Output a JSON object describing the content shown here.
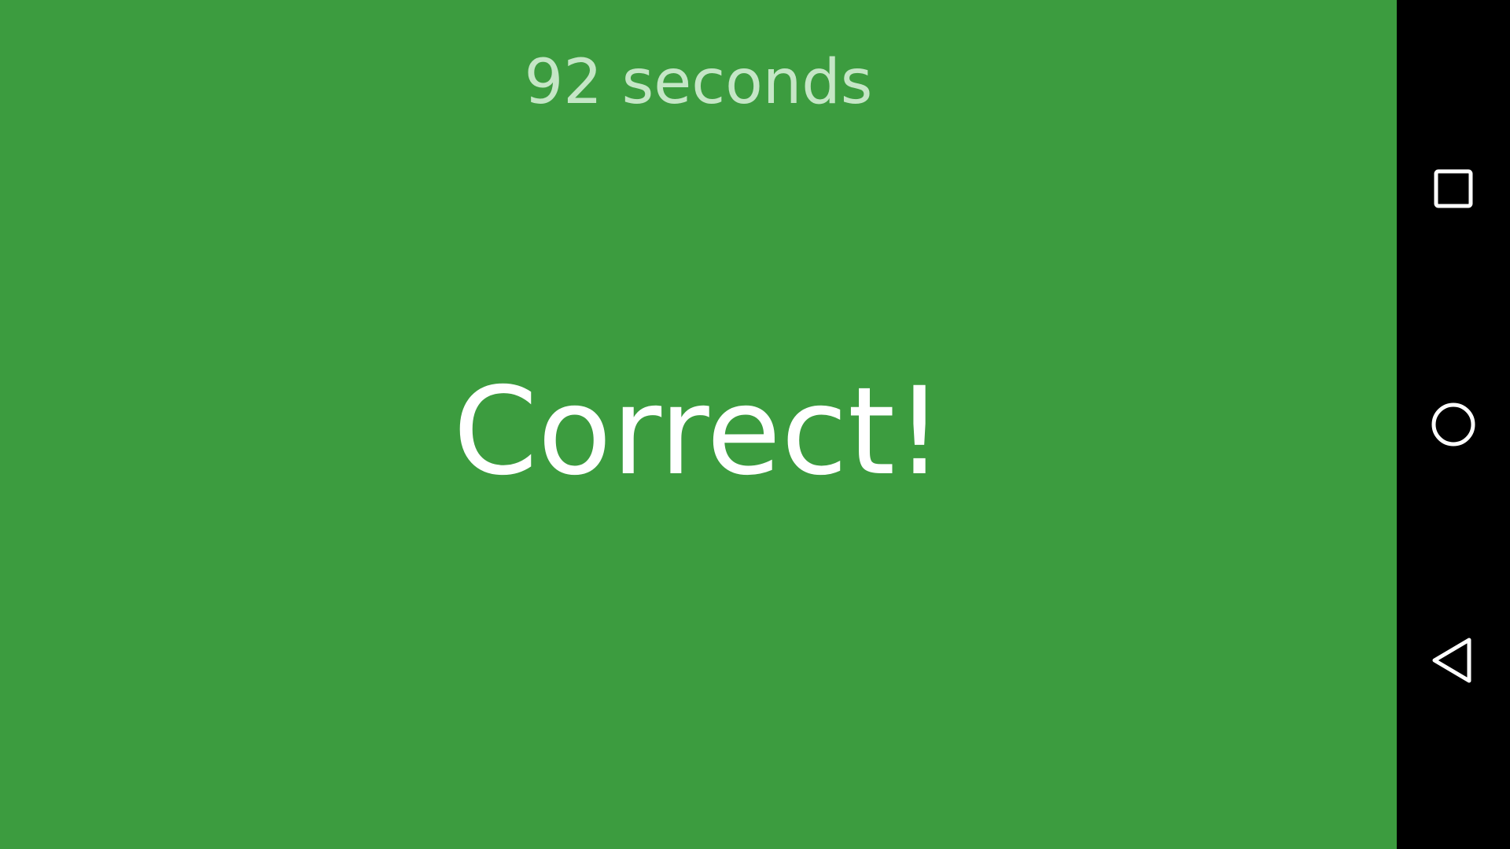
{
  "game": {
    "timer_text": "92 seconds",
    "result_text": "Correct!",
    "background_color": "#3c9c3f",
    "timer_color": "#c5e6c6",
    "result_color": "#ffffff"
  },
  "navigation_bar": {
    "buttons": [
      {
        "name": "recents",
        "icon": "square-icon"
      },
      {
        "name": "home",
        "icon": "circle-icon"
      },
      {
        "name": "back",
        "icon": "triangle-back-icon"
      }
    ]
  }
}
